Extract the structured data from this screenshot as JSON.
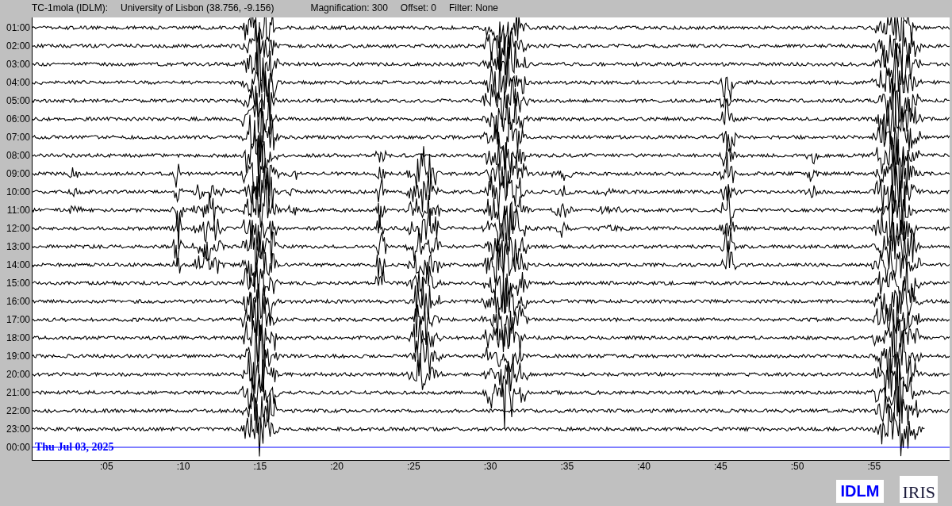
{
  "header": {
    "station": "TC-1mola (IDLM):",
    "location": "University of Lisbon (38.756, -9.156)",
    "magnification": "Magnification: 300",
    "offset": "Offset: 0",
    "filter": "Filter: None"
  },
  "traces": [
    {
      "label": "01:00",
      "kind": "recorded"
    },
    {
      "label": "02:00",
      "kind": "recorded"
    },
    {
      "label": "03:00",
      "kind": "recorded"
    },
    {
      "label": "04:00",
      "kind": "recorded"
    },
    {
      "label": "05:00",
      "kind": "recorded"
    },
    {
      "label": "06:00",
      "kind": "recorded"
    },
    {
      "label": "07:00",
      "kind": "recorded"
    },
    {
      "label": "08:00",
      "kind": "recorded"
    },
    {
      "label": "09:00",
      "kind": "recorded"
    },
    {
      "label": "10:00",
      "kind": "recorded"
    },
    {
      "label": "11:00",
      "kind": "recorded"
    },
    {
      "label": "12:00",
      "kind": "recorded"
    },
    {
      "label": "13:00",
      "kind": "recorded"
    },
    {
      "label": "14:00",
      "kind": "recorded"
    },
    {
      "label": "15:00",
      "kind": "recorded"
    },
    {
      "label": "16:00",
      "kind": "recorded"
    },
    {
      "label": "17:00",
      "kind": "recorded"
    },
    {
      "label": "18:00",
      "kind": "recorded"
    },
    {
      "label": "19:00",
      "kind": "recorded"
    },
    {
      "label": "20:00",
      "kind": "recorded"
    },
    {
      "label": "21:00",
      "kind": "recorded"
    },
    {
      "label": "22:00",
      "kind": "recorded"
    },
    {
      "label": "23:00",
      "kind": "partial"
    },
    {
      "label": "00:00",
      "kind": "empty"
    }
  ],
  "date_label": "Thu Jul 03, 2025",
  "x_ticks": [
    ":05",
    ":10",
    ":15",
    ":20",
    ":25",
    ":30",
    ":35",
    ":40",
    ":45",
    ":50",
    ":55"
  ],
  "logos": {
    "idlm": "IDLM",
    "iris": "IRIS"
  }
}
